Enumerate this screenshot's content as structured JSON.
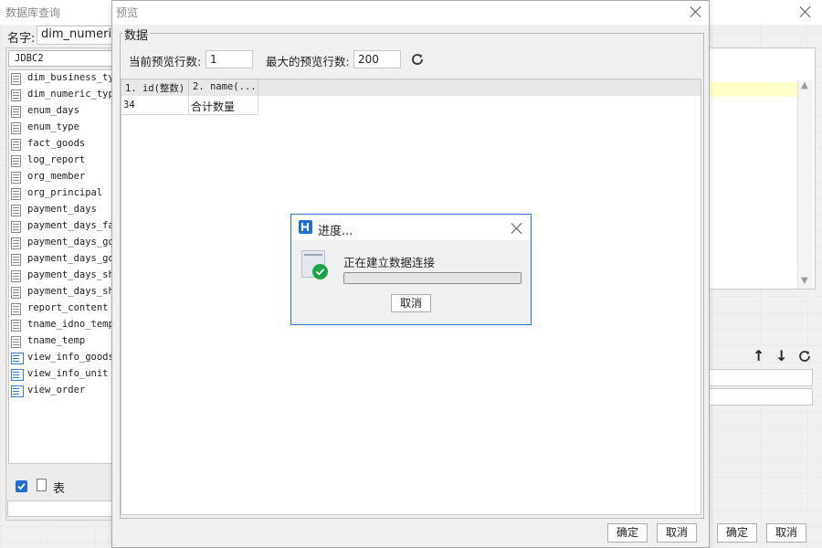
{
  "bg_window": {
    "title": "数据库查询",
    "name_label": "名字:",
    "name_value": "dim_numeric_",
    "connection": "JDBC2",
    "tables": [
      {
        "label": "dim_business_typ",
        "kind": "table"
      },
      {
        "label": "dim_numeric_type",
        "kind": "table"
      },
      {
        "label": "enum_days",
        "kind": "table"
      },
      {
        "label": "enum_type",
        "kind": "table"
      },
      {
        "label": "fact_goods",
        "kind": "table"
      },
      {
        "label": "log_report",
        "kind": "table"
      },
      {
        "label": "org_member",
        "kind": "table"
      },
      {
        "label": "org_principal",
        "kind": "table"
      },
      {
        "label": "payment_days",
        "kind": "table"
      },
      {
        "label": "payment_days_fac",
        "kind": "table"
      },
      {
        "label": "payment_days_goo",
        "kind": "table"
      },
      {
        "label": "payment_days_goo",
        "kind": "table"
      },
      {
        "label": "payment_days_sho",
        "kind": "table"
      },
      {
        "label": "payment_days_sho",
        "kind": "table"
      },
      {
        "label": "report_content",
        "kind": "table"
      },
      {
        "label": "tname_idno_temp",
        "kind": "table"
      },
      {
        "label": "tname_temp",
        "kind": "table"
      },
      {
        "label": "view_info_goods",
        "kind": "view"
      },
      {
        "label": "view_info_unit",
        "kind": "view"
      },
      {
        "label": "view_order",
        "kind": "view"
      }
    ],
    "table_checkbox_label": "表",
    "ok_label": "确定",
    "cancel_label": "取消"
  },
  "preview": {
    "title": "预览",
    "section_label": "数据",
    "current_rows_label": "当前预览行数:",
    "current_rows_value": "1",
    "max_rows_label": "最大的预览行数:",
    "max_rows_value": "200",
    "columns": [
      "1. id(整数)",
      "2. name(..."
    ],
    "rows": [
      [
        "34",
        "合计数量"
      ]
    ],
    "ok_label": "确定",
    "cancel_label": "取消"
  },
  "progress": {
    "title": "进度...",
    "message": "正在建立数据连接",
    "progress": 0,
    "cancel_label": "取消"
  },
  "colors": {
    "accent": "#1f6fce",
    "success": "#1aa34a",
    "highlight_row": "#ffffc8",
    "checkbox": "#1f6fce"
  }
}
